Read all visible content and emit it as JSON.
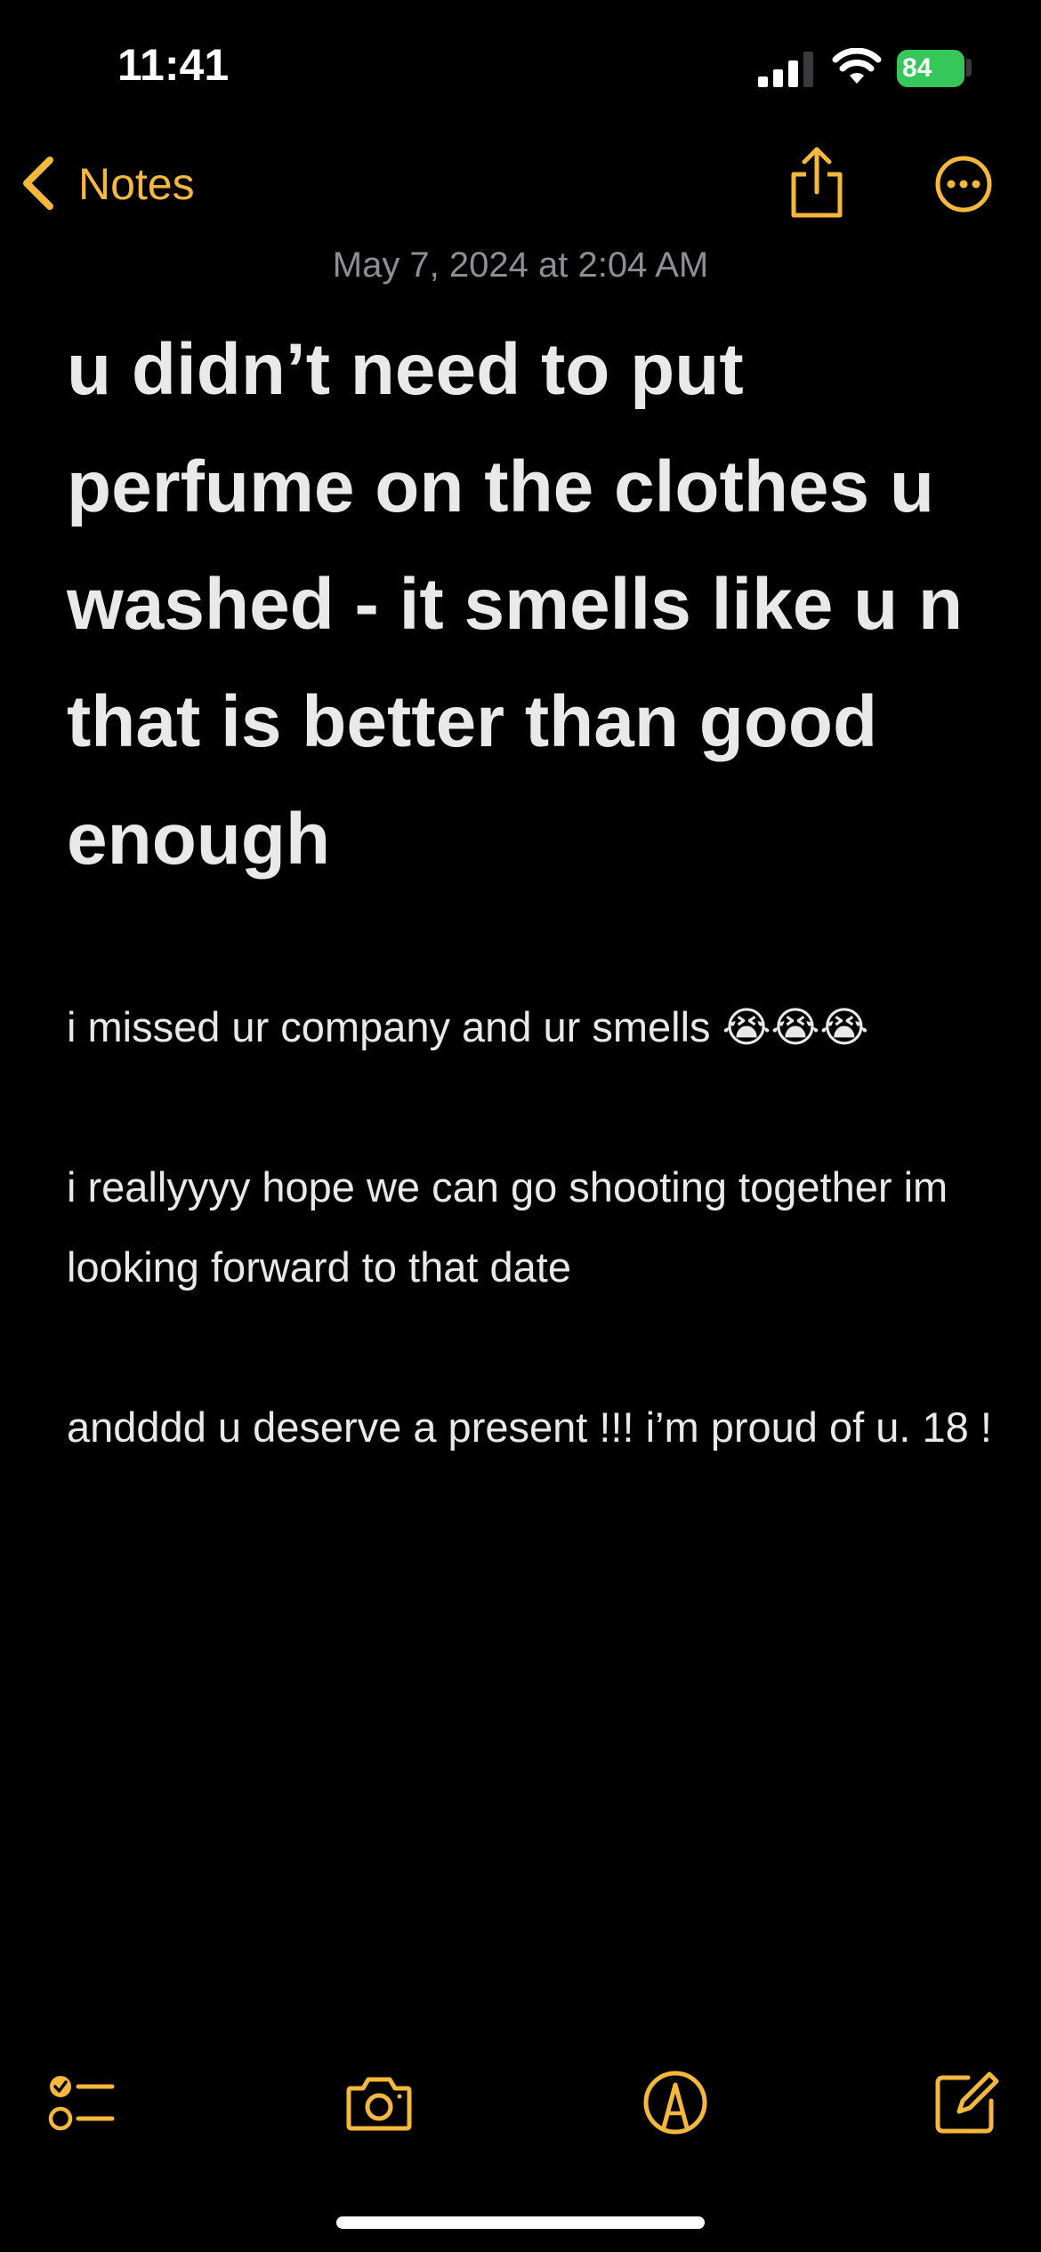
{
  "status_bar": {
    "time": "11:41",
    "battery": "84"
  },
  "nav": {
    "back_label": "Notes",
    "back_icon": "chevron-left-icon",
    "share_icon": "share-icon",
    "more_icon": "ellipsis-circle-icon"
  },
  "note": {
    "date": "May 7, 2024 at 2:04 AM",
    "title": "u didn’t need to put perfume on the clothes u washed - it smells like u n that is better than good enough",
    "paragraphs": [
      "i missed ur company and ur smells 😭😭😭",
      "i reallyyyy hope we can go shooting together im looking forward to that date",
      "andddd u deserve a present !!! i’m proud of u. 18 !"
    ]
  },
  "toolbar": {
    "icons": [
      "checklist-icon",
      "camera-icon",
      "markup-icon",
      "compose-icon"
    ]
  },
  "colors": {
    "accent": "#f5b83d",
    "background": "#000000",
    "text": "#e9e9ea",
    "secondary_text": "#8e8e93",
    "battery": "#35c759"
  }
}
